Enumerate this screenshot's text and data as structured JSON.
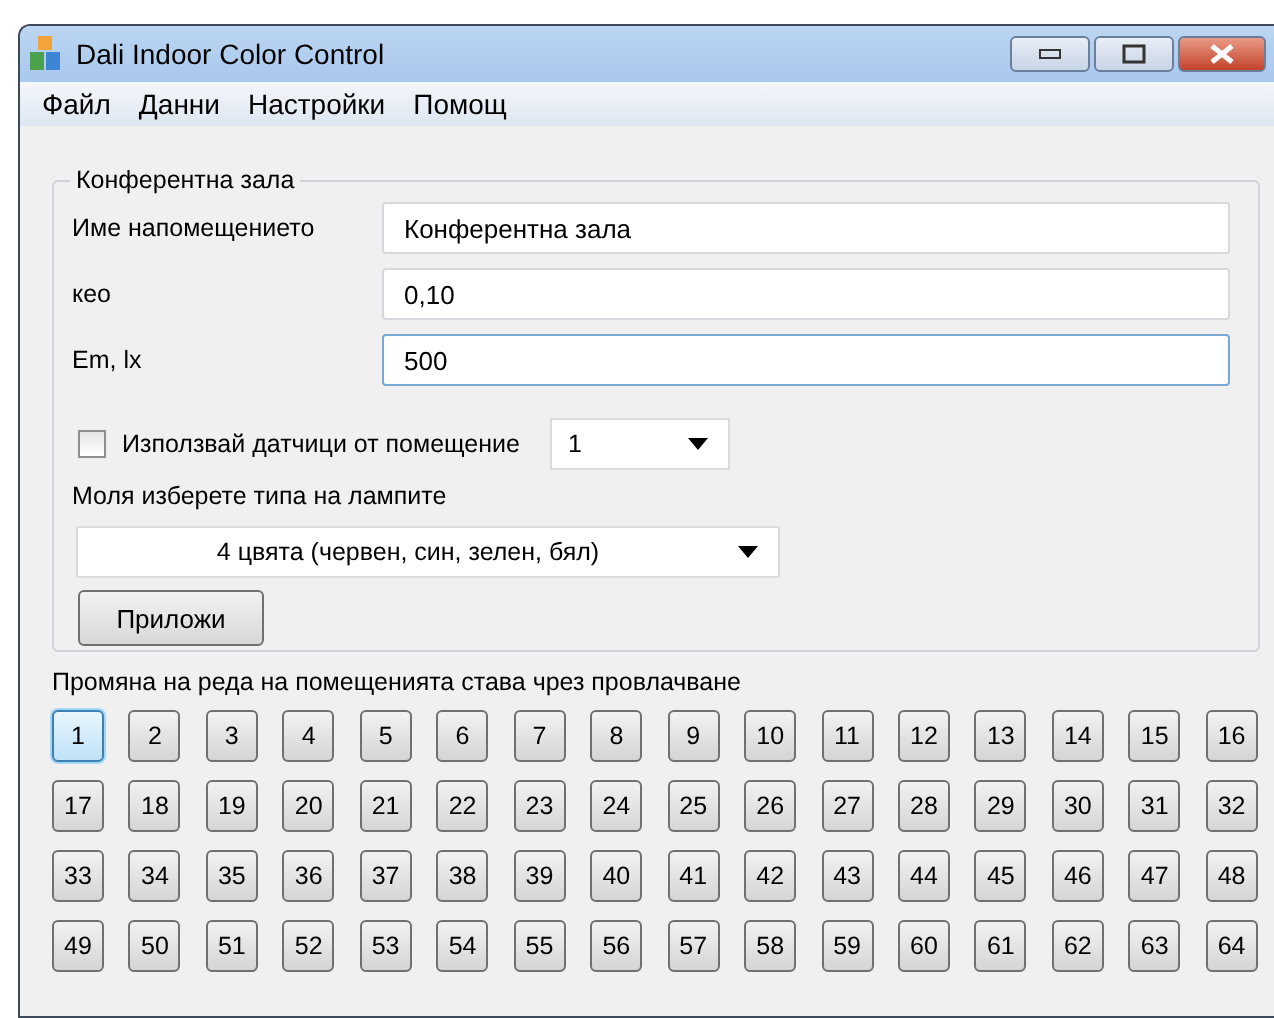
{
  "window": {
    "title": "Dali Indoor Color Control"
  },
  "menu": [
    "Файл",
    "Данни",
    "Настройки",
    "Помощ"
  ],
  "group": {
    "title": "Конферентна зала",
    "fields": [
      {
        "label": "Име напомещението",
        "value": "Конферентна зала",
        "focused": false
      },
      {
        "label": "кео",
        "value": "0,10",
        "focused": false
      },
      {
        "label": "Em, lx",
        "value": "500",
        "focused": true
      }
    ],
    "sensor": {
      "label": "Използвай датчици от помещение",
      "checked": false,
      "value": "1"
    },
    "lamp_label": "Моля изберете типа на лампите",
    "lamp_type": "4 цвята (червен, син, зелен, бял)",
    "apply_button": "Приложи"
  },
  "hint": "Промяна на реда на помещенията става чрез провлачване",
  "rooms": [
    {
      "label": "1",
      "selected": true
    },
    {
      "label": "2",
      "selected": false
    },
    {
      "label": "3",
      "selected": false
    },
    {
      "label": "4",
      "selected": false
    },
    {
      "label": "5",
      "selected": false
    },
    {
      "label": "6",
      "selected": false
    },
    {
      "label": "7",
      "selected": false
    },
    {
      "label": "8",
      "selected": false
    },
    {
      "label": "9",
      "selected": false
    },
    {
      "label": "10",
      "selected": false
    },
    {
      "label": "11",
      "selected": false
    },
    {
      "label": "12",
      "selected": false
    },
    {
      "label": "13",
      "selected": false
    },
    {
      "label": "14",
      "selected": false
    },
    {
      "label": "15",
      "selected": false
    },
    {
      "label": "16",
      "selected": false
    },
    {
      "label": "17",
      "selected": false
    },
    {
      "label": "18",
      "selected": false
    },
    {
      "label": "19",
      "selected": false
    },
    {
      "label": "20",
      "selected": false
    },
    {
      "label": "21",
      "selected": false
    },
    {
      "label": "22",
      "selected": false
    },
    {
      "label": "23",
      "selected": false
    },
    {
      "label": "24",
      "selected": false
    },
    {
      "label": "25",
      "selected": false
    },
    {
      "label": "26",
      "selected": false
    },
    {
      "label": "27",
      "selected": false
    },
    {
      "label": "28",
      "selected": false
    },
    {
      "label": "29",
      "selected": false
    },
    {
      "label": "30",
      "selected": false
    },
    {
      "label": "31",
      "selected": false
    },
    {
      "label": "32",
      "selected": false
    },
    {
      "label": "33",
      "selected": false
    },
    {
      "label": "34",
      "selected": false
    },
    {
      "label": "35",
      "selected": false
    },
    {
      "label": "36",
      "selected": false
    },
    {
      "label": "37",
      "selected": false
    },
    {
      "label": "38",
      "selected": false
    },
    {
      "label": "39",
      "selected": false
    },
    {
      "label": "40",
      "selected": false
    },
    {
      "label": "41",
      "selected": false
    },
    {
      "label": "42",
      "selected": false
    },
    {
      "label": "43",
      "selected": false
    },
    {
      "label": "44",
      "selected": false
    },
    {
      "label": "45",
      "selected": false
    },
    {
      "label": "46",
      "selected": false
    },
    {
      "label": "47",
      "selected": false
    },
    {
      "label": "48",
      "selected": false
    },
    {
      "label": "49",
      "selected": false
    },
    {
      "label": "50",
      "selected": false
    },
    {
      "label": "51",
      "selected": false
    },
    {
      "label": "52",
      "selected": false
    },
    {
      "label": "53",
      "selected": false
    },
    {
      "label": "54",
      "selected": false
    },
    {
      "label": "55",
      "selected": false
    },
    {
      "label": "56",
      "selected": false
    },
    {
      "label": "57",
      "selected": false
    },
    {
      "label": "58",
      "selected": false
    },
    {
      "label": "59",
      "selected": false
    },
    {
      "label": "60",
      "selected": false
    },
    {
      "label": "61",
      "selected": false
    },
    {
      "label": "62",
      "selected": false
    },
    {
      "label": "63",
      "selected": false
    },
    {
      "label": "64",
      "selected": false
    }
  ]
}
